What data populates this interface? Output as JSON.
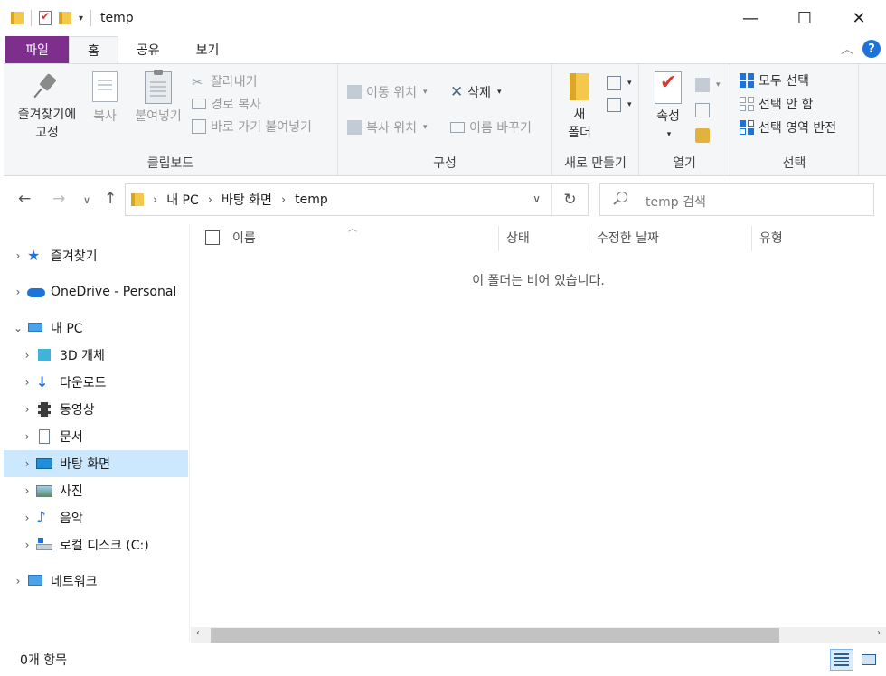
{
  "window": {
    "title": "temp",
    "minimize": "—",
    "maximize": "☐",
    "close": "✕"
  },
  "quick_access": {
    "dropdown": "▾"
  },
  "ribbon_tabs": {
    "file": "파일",
    "home": "홈",
    "share": "공유",
    "view": "보기"
  },
  "ribbon": {
    "clipboard": {
      "label": "클립보드",
      "pin_line1": "즐겨찾기에",
      "pin_line2": "고정",
      "copy": "복사",
      "paste": "붙여넣기",
      "cut": "잘라내기",
      "copy_path": "경로 복사",
      "paste_shortcut": "바로 가기 붙여넣기"
    },
    "organize": {
      "label": "구성",
      "move_to": "이동 위치",
      "copy_to": "복사 위치",
      "delete": "삭제",
      "rename": "이름 바꾸기"
    },
    "new": {
      "label": "새로 만들기",
      "new_folder_line1": "새",
      "new_folder_line2": "폴더"
    },
    "open": {
      "label": "열기",
      "properties": "속성"
    },
    "select": {
      "label": "선택",
      "select_all": "모두 선택",
      "select_none": "선택 안 함",
      "invert": "선택 영역 반전"
    }
  },
  "address": {
    "crumbs": [
      "내 PC",
      "바탕 화면",
      "temp"
    ],
    "search_placeholder": "temp 검색"
  },
  "nav_pane": {
    "items": [
      {
        "label": "즐겨찾기",
        "icon": "star-icon"
      },
      {
        "label": "OneDrive - Personal",
        "icon": "cloud-icon"
      },
      {
        "label": "내 PC",
        "icon": "computer-icon"
      },
      {
        "label": "3D 개체",
        "icon": "cube-icon"
      },
      {
        "label": "다운로드",
        "icon": "download-icon"
      },
      {
        "label": "동영상",
        "icon": "video-icon"
      },
      {
        "label": "문서",
        "icon": "document-icon"
      },
      {
        "label": "바탕 화면",
        "icon": "desktop-icon"
      },
      {
        "label": "사진",
        "icon": "picture-icon"
      },
      {
        "label": "음악",
        "icon": "music-icon"
      },
      {
        "label": "로컬 디스크 (C:)",
        "icon": "drive-icon"
      },
      {
        "label": "네트워크",
        "icon": "network-icon"
      }
    ]
  },
  "columns": {
    "name": "이름",
    "status": "상태",
    "modified": "수정한 날짜",
    "type": "유형"
  },
  "content": {
    "empty_message": "이 폴더는 비어 있습니다."
  },
  "status": {
    "item_count": "0개 항목"
  },
  "colors": {
    "file_tab": "#7e2f8e",
    "accent": "#1e73d8",
    "selection": "#cce8ff"
  }
}
